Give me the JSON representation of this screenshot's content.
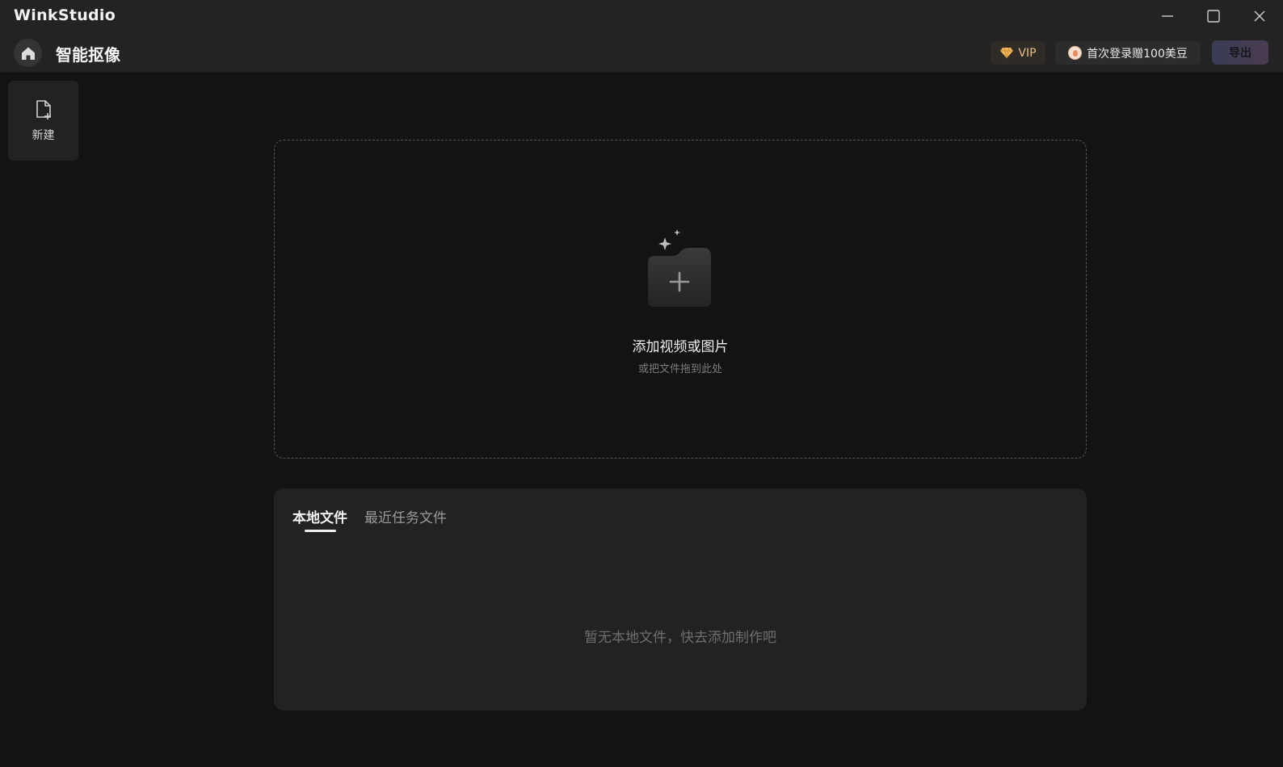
{
  "app": {
    "name": "WinkStudio"
  },
  "window_controls": {
    "minimize_icon": "minimize-icon",
    "maximize_icon": "maximize-icon",
    "close_icon": "close-icon"
  },
  "header": {
    "home_icon": "home-icon",
    "title": "智能抠像",
    "vip_label": "VIP",
    "vip_icon": "diamond-icon",
    "promo_label": "首次登录赠100美豆",
    "promo_icon": "bean-coin-icon",
    "export_label": "导出"
  },
  "sidebar": {
    "new_label": "新建",
    "new_icon": "new-file-icon"
  },
  "drop_zone": {
    "icon": "add-folder-icon",
    "title": "添加视频或图片",
    "subtitle": "或把文件拖到此处"
  },
  "files_panel": {
    "tabs": [
      {
        "label": "本地文件",
        "active": true
      },
      {
        "label": "最近任务文件",
        "active": false
      }
    ],
    "empty_message": "暂无本地文件，快去添加制作吧"
  },
  "colors": {
    "background": "#131313",
    "surface": "#222222",
    "vip_gold": "#e8bf88",
    "export_gradient_start": "#3a3c56",
    "export_gradient_end": "#4a3c50"
  }
}
